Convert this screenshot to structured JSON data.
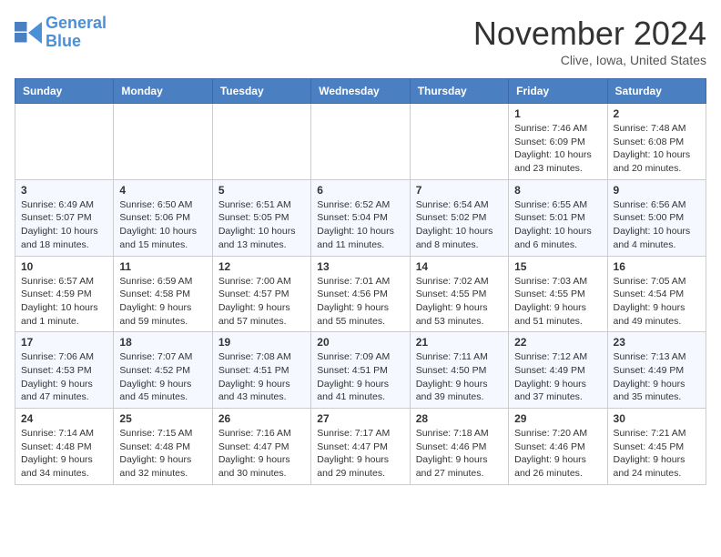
{
  "header": {
    "logo_line1": "General",
    "logo_line2": "Blue",
    "month": "November 2024",
    "location": "Clive, Iowa, United States"
  },
  "days_of_week": [
    "Sunday",
    "Monday",
    "Tuesday",
    "Wednesday",
    "Thursday",
    "Friday",
    "Saturday"
  ],
  "weeks": [
    [
      {
        "day": "",
        "info": ""
      },
      {
        "day": "",
        "info": ""
      },
      {
        "day": "",
        "info": ""
      },
      {
        "day": "",
        "info": ""
      },
      {
        "day": "",
        "info": ""
      },
      {
        "day": "1",
        "info": "Sunrise: 7:46 AM\nSunset: 6:09 PM\nDaylight: 10 hours and 23 minutes."
      },
      {
        "day": "2",
        "info": "Sunrise: 7:48 AM\nSunset: 6:08 PM\nDaylight: 10 hours and 20 minutes."
      }
    ],
    [
      {
        "day": "3",
        "info": "Sunrise: 6:49 AM\nSunset: 5:07 PM\nDaylight: 10 hours and 18 minutes."
      },
      {
        "day": "4",
        "info": "Sunrise: 6:50 AM\nSunset: 5:06 PM\nDaylight: 10 hours and 15 minutes."
      },
      {
        "day": "5",
        "info": "Sunrise: 6:51 AM\nSunset: 5:05 PM\nDaylight: 10 hours and 13 minutes."
      },
      {
        "day": "6",
        "info": "Sunrise: 6:52 AM\nSunset: 5:04 PM\nDaylight: 10 hours and 11 minutes."
      },
      {
        "day": "7",
        "info": "Sunrise: 6:54 AM\nSunset: 5:02 PM\nDaylight: 10 hours and 8 minutes."
      },
      {
        "day": "8",
        "info": "Sunrise: 6:55 AM\nSunset: 5:01 PM\nDaylight: 10 hours and 6 minutes."
      },
      {
        "day": "9",
        "info": "Sunrise: 6:56 AM\nSunset: 5:00 PM\nDaylight: 10 hours and 4 minutes."
      }
    ],
    [
      {
        "day": "10",
        "info": "Sunrise: 6:57 AM\nSunset: 4:59 PM\nDaylight: 10 hours and 1 minute."
      },
      {
        "day": "11",
        "info": "Sunrise: 6:59 AM\nSunset: 4:58 PM\nDaylight: 9 hours and 59 minutes."
      },
      {
        "day": "12",
        "info": "Sunrise: 7:00 AM\nSunset: 4:57 PM\nDaylight: 9 hours and 57 minutes."
      },
      {
        "day": "13",
        "info": "Sunrise: 7:01 AM\nSunset: 4:56 PM\nDaylight: 9 hours and 55 minutes."
      },
      {
        "day": "14",
        "info": "Sunrise: 7:02 AM\nSunset: 4:55 PM\nDaylight: 9 hours and 53 minutes."
      },
      {
        "day": "15",
        "info": "Sunrise: 7:03 AM\nSunset: 4:55 PM\nDaylight: 9 hours and 51 minutes."
      },
      {
        "day": "16",
        "info": "Sunrise: 7:05 AM\nSunset: 4:54 PM\nDaylight: 9 hours and 49 minutes."
      }
    ],
    [
      {
        "day": "17",
        "info": "Sunrise: 7:06 AM\nSunset: 4:53 PM\nDaylight: 9 hours and 47 minutes."
      },
      {
        "day": "18",
        "info": "Sunrise: 7:07 AM\nSunset: 4:52 PM\nDaylight: 9 hours and 45 minutes."
      },
      {
        "day": "19",
        "info": "Sunrise: 7:08 AM\nSunset: 4:51 PM\nDaylight: 9 hours and 43 minutes."
      },
      {
        "day": "20",
        "info": "Sunrise: 7:09 AM\nSunset: 4:51 PM\nDaylight: 9 hours and 41 minutes."
      },
      {
        "day": "21",
        "info": "Sunrise: 7:11 AM\nSunset: 4:50 PM\nDaylight: 9 hours and 39 minutes."
      },
      {
        "day": "22",
        "info": "Sunrise: 7:12 AM\nSunset: 4:49 PM\nDaylight: 9 hours and 37 minutes."
      },
      {
        "day": "23",
        "info": "Sunrise: 7:13 AM\nSunset: 4:49 PM\nDaylight: 9 hours and 35 minutes."
      }
    ],
    [
      {
        "day": "24",
        "info": "Sunrise: 7:14 AM\nSunset: 4:48 PM\nDaylight: 9 hours and 34 minutes."
      },
      {
        "day": "25",
        "info": "Sunrise: 7:15 AM\nSunset: 4:48 PM\nDaylight: 9 hours and 32 minutes."
      },
      {
        "day": "26",
        "info": "Sunrise: 7:16 AM\nSunset: 4:47 PM\nDaylight: 9 hours and 30 minutes."
      },
      {
        "day": "27",
        "info": "Sunrise: 7:17 AM\nSunset: 4:47 PM\nDaylight: 9 hours and 29 minutes."
      },
      {
        "day": "28",
        "info": "Sunrise: 7:18 AM\nSunset: 4:46 PM\nDaylight: 9 hours and 27 minutes."
      },
      {
        "day": "29",
        "info": "Sunrise: 7:20 AM\nSunset: 4:46 PM\nDaylight: 9 hours and 26 minutes."
      },
      {
        "day": "30",
        "info": "Sunrise: 7:21 AM\nSunset: 4:45 PM\nDaylight: 9 hours and 24 minutes."
      }
    ]
  ]
}
